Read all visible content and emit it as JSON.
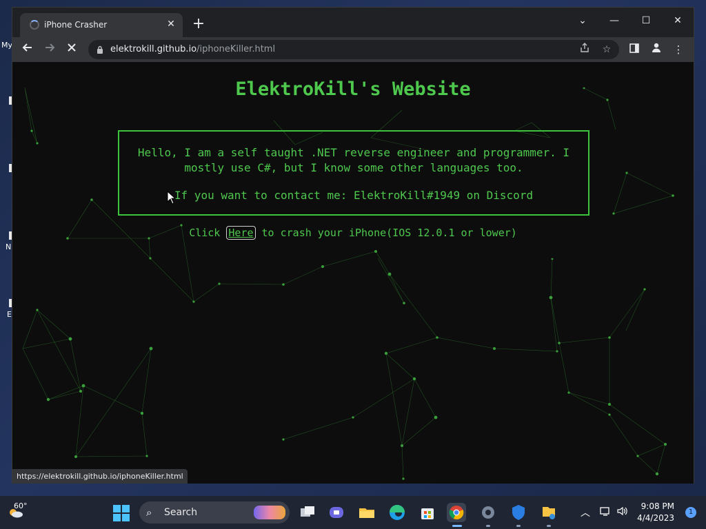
{
  "desktop": {
    "fragments": [
      "My",
      "N",
      "E"
    ]
  },
  "browser": {
    "tab": {
      "title": "iPhone Crasher",
      "close": "✕"
    },
    "new_tab": "+",
    "window_controls": {
      "tab_search": "⌄",
      "minimize": "—",
      "maximize": "☐",
      "close": "✕"
    },
    "url_host": "elektrokill.github.io",
    "url_path": "/iphoneKiller.html",
    "status_url": "https://elektrokill.github.io/iphoneKiller.html"
  },
  "page": {
    "title": "ElektroKill's Website",
    "intro": "Hello, I am a self taught .NET reverse engineer and programmer. I mostly use C#, but I know some other languages too.",
    "contact": "If you want to contact me: ElektroKill#1949 on Discord",
    "crash_prefix": "Click",
    "crash_link": "Here",
    "crash_suffix": "to crash your iPhone(IOS 12.0.1 or lower)"
  },
  "taskbar": {
    "weather_temp": "60°",
    "search_label": "Search",
    "time": "9:08 PM",
    "date": "4/4/2023",
    "notifications": "1"
  },
  "colors": {
    "accent_green": "#4ec94e",
    "page_bg": "#0d0d0d",
    "chrome_dark": "#202124",
    "chrome_toolbar": "#35363a"
  }
}
